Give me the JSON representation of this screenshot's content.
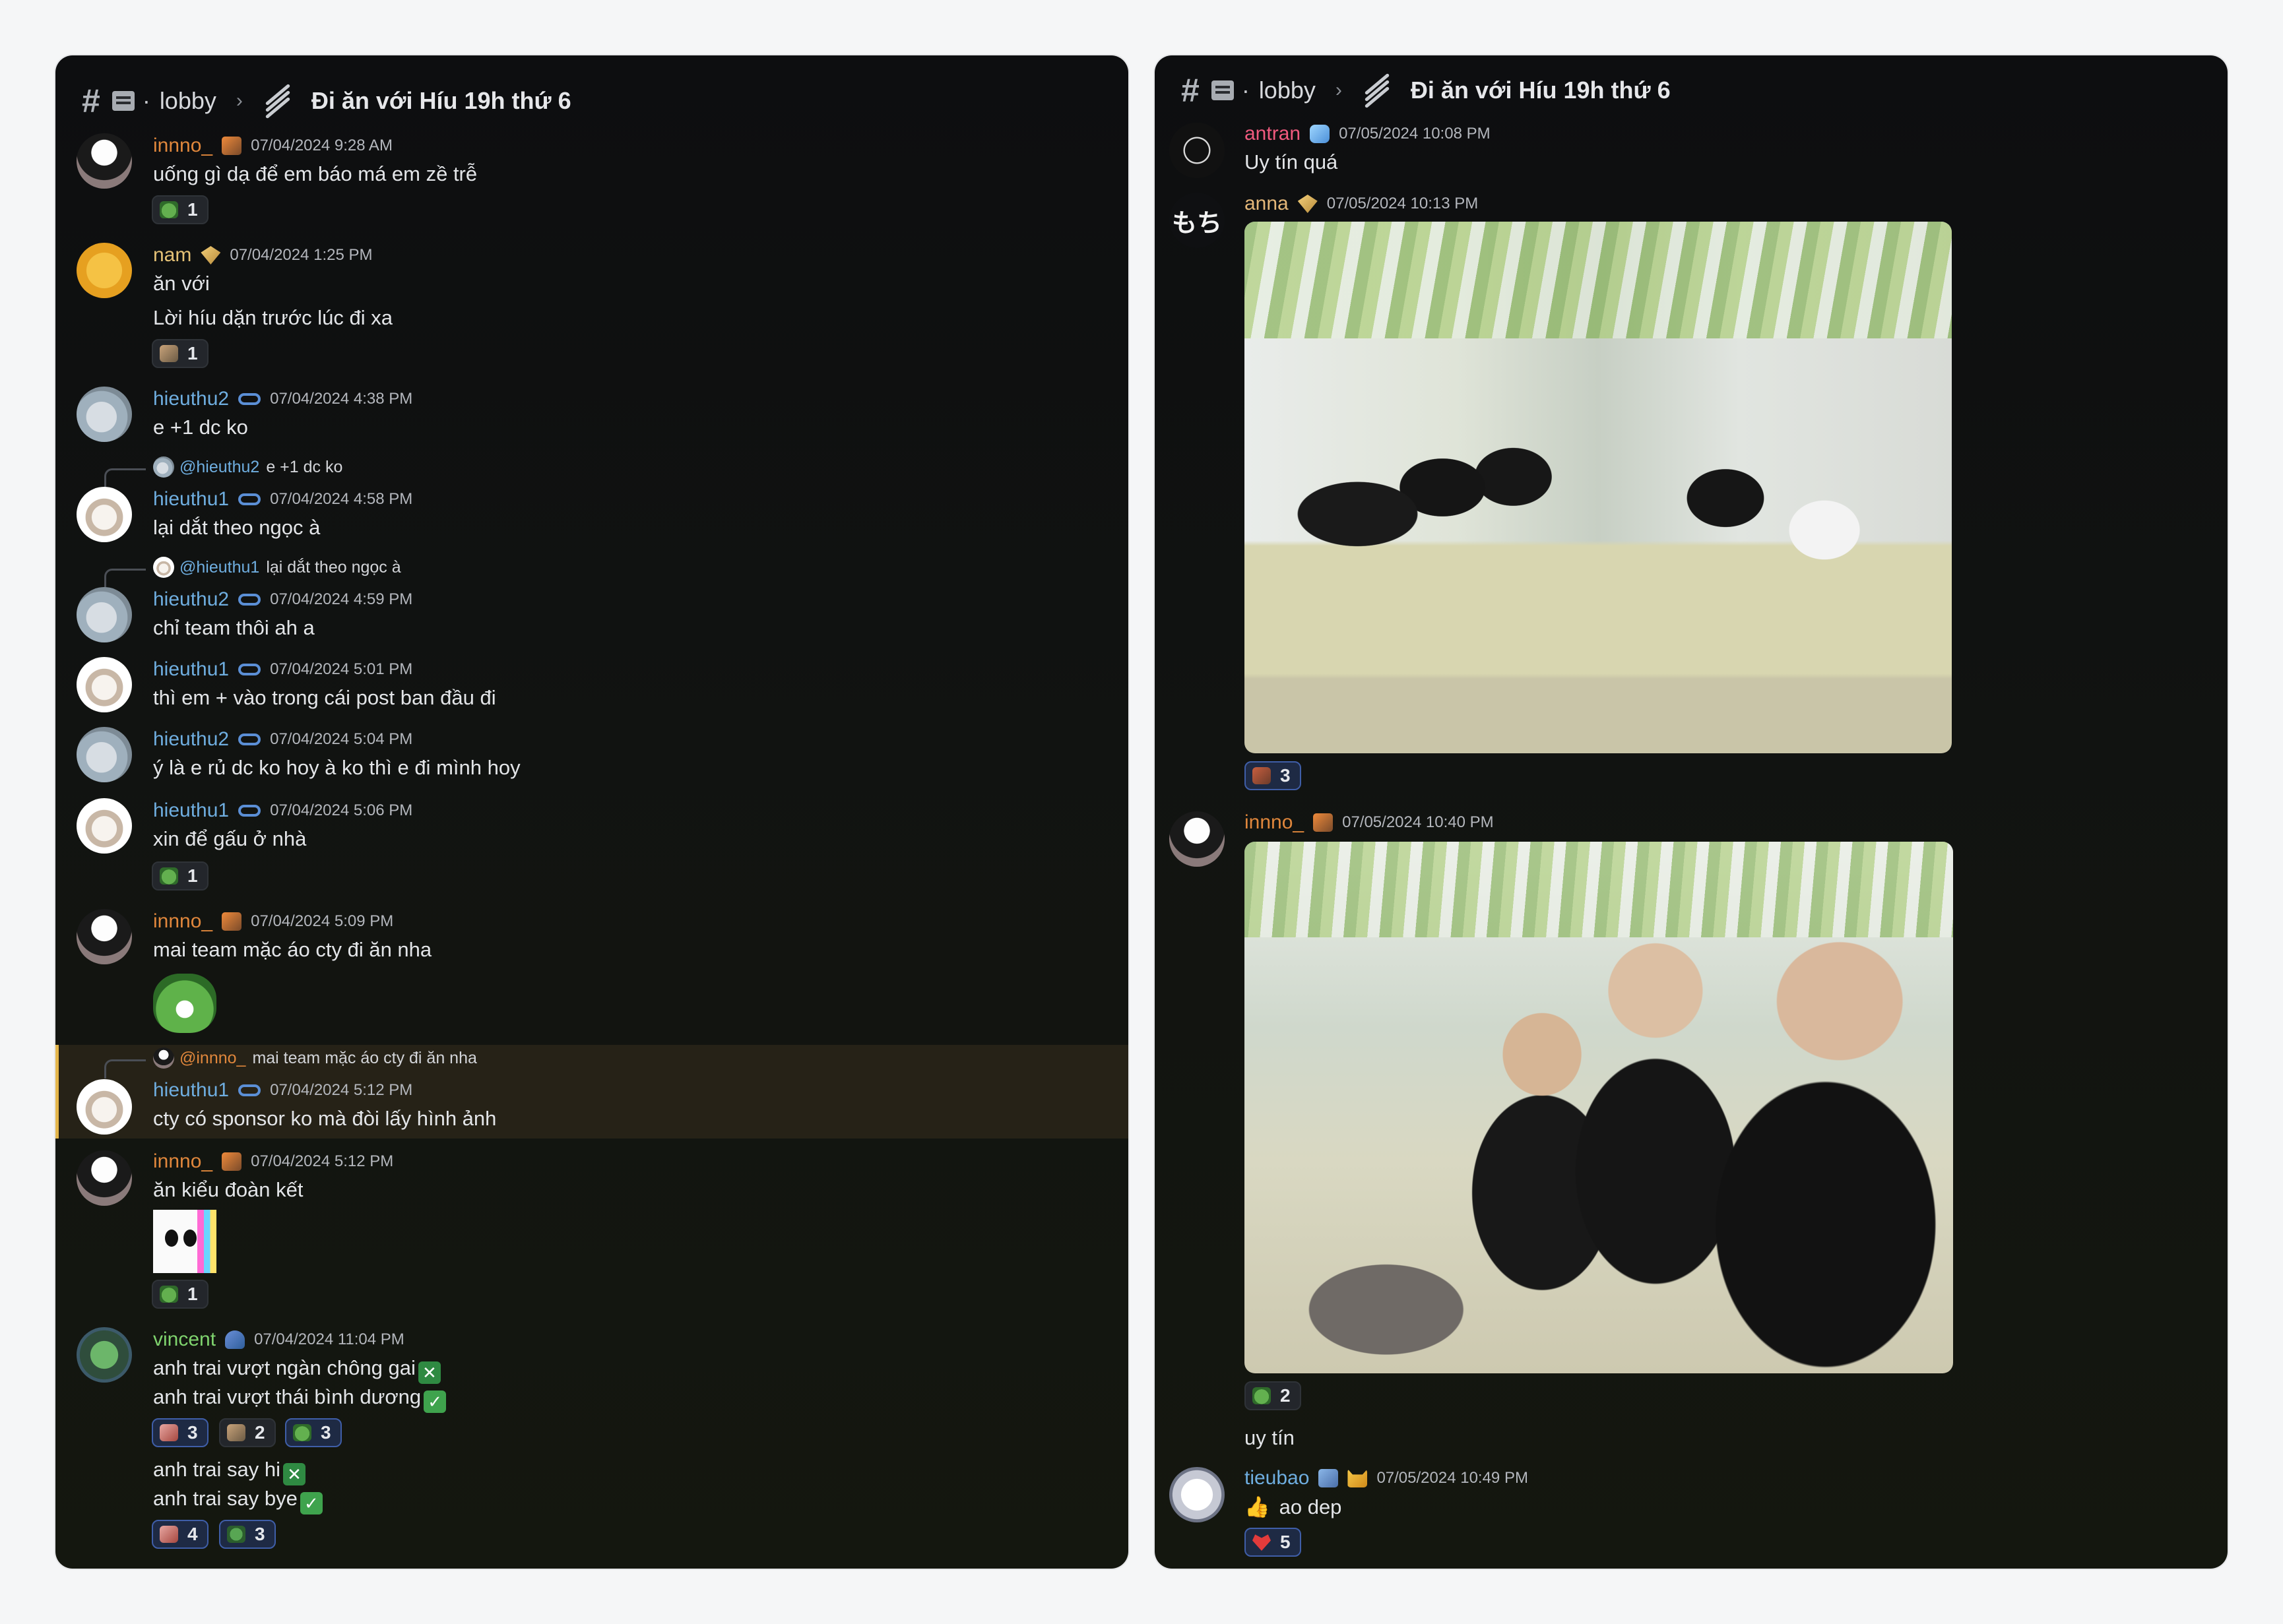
{
  "header": {
    "channel": "lobby",
    "thread": "Đi ăn với Híu 19h thứ 6"
  },
  "left": {
    "messages": [
      {
        "user": "innno_",
        "time": "07/04/2024 9:28 AM",
        "lines": [
          "uống gì dạ để em báo má em zề trễ"
        ],
        "reactions": [
          {
            "count": "1"
          }
        ]
      },
      {
        "user": "nam",
        "time": "07/04/2024 1:25 PM",
        "lines": [
          "ăn với",
          "Lời híu dặn trước lúc đi xa"
        ],
        "reactions": [
          {
            "count": "1"
          }
        ]
      },
      {
        "user": "hieuthu2",
        "time": "07/04/2024 4:38 PM",
        "lines": [
          "e +1 dc ko"
        ]
      },
      {
        "reply_mention": "@hieuthu2",
        "reply_text": "e +1 dc ko",
        "user": "hieuthu1",
        "time": "07/04/2024 4:58 PM",
        "lines": [
          "lại dắt theo ngọc à"
        ]
      },
      {
        "reply_mention": "@hieuthu1",
        "reply_text": "lại dắt theo ngọc à",
        "user": "hieuthu2",
        "time": "07/04/2024 4:59 PM",
        "lines": [
          "chỉ team thôi ah a"
        ]
      },
      {
        "user": "hieuthu1",
        "time": "07/04/2024 5:01 PM",
        "lines": [
          "thì em + vào trong cái post ban đầu đi"
        ]
      },
      {
        "user": "hieuthu2",
        "time": "07/04/2024 5:04 PM",
        "lines": [
          "ý là e rủ dc ko hoy à ko thì e đi mình hoy"
        ]
      },
      {
        "user": "hieuthu1",
        "time": "07/04/2024 5:06 PM",
        "lines": [
          "xin để gấu ở nhà"
        ],
        "reactions": [
          {
            "count": "1"
          }
        ]
      },
      {
        "user": "innno_",
        "time": "07/04/2024 5:09 PM",
        "lines": [
          "mai team mặc áo cty đi ăn nha"
        ]
      },
      {
        "reply_mention": "@innno_",
        "reply_text": "mai team mặc áo cty đi ăn nha",
        "user": "hieuthu1",
        "time": "07/04/2024 5:12 PM",
        "lines": [
          "cty có sponsor ko mà đòi lấy hình ảnh"
        ]
      },
      {
        "user": "innno_",
        "time": "07/04/2024 5:12 PM",
        "lines": [
          "ăn kiểu đoàn kết"
        ],
        "reactions": [
          {
            "count": "1"
          }
        ]
      },
      {
        "user": "vincent",
        "time": "07/04/2024 11:04 PM",
        "lines": [
          "anh trai vượt ngàn chông gai",
          "anh trai vượt thái bình dương",
          "anh trai say hi",
          "anh trai say bye"
        ],
        "reactions": [
          {
            "count": "3"
          },
          {
            "count": "2"
          },
          {
            "count": "3"
          }
        ],
        "reactions2": [
          {
            "count": "4"
          },
          {
            "count": "3"
          }
        ]
      }
    ]
  },
  "right": {
    "messages": [
      {
        "user": "antran",
        "time": "07/05/2024 10:08 PM",
        "lines": [
          "Uy tín quá"
        ]
      },
      {
        "avatar_text": "もち",
        "user": "anna",
        "time": "07/05/2024 10:13 PM",
        "reactions": [
          {
            "count": "3"
          }
        ]
      },
      {
        "user": "innno_",
        "time": "07/05/2024 10:40 PM",
        "reactions": [
          {
            "count": "2"
          }
        ],
        "after": "uy tín"
      },
      {
        "user": "tieubao",
        "time": "07/05/2024 10:49 PM",
        "lines": [
          "ao dep"
        ],
        "reactions": [
          {
            "count": "5"
          }
        ]
      }
    ]
  },
  "colors": {
    "panel_bg": "#0d0e10",
    "innno": "#e0873c",
    "hieu": "#6faee0",
    "vincent": "#7fd36e",
    "antran": "#f05a7e",
    "anna": "#e4b779",
    "reaction_active": "#3f5ea8",
    "highlight": "#e3b54a"
  }
}
